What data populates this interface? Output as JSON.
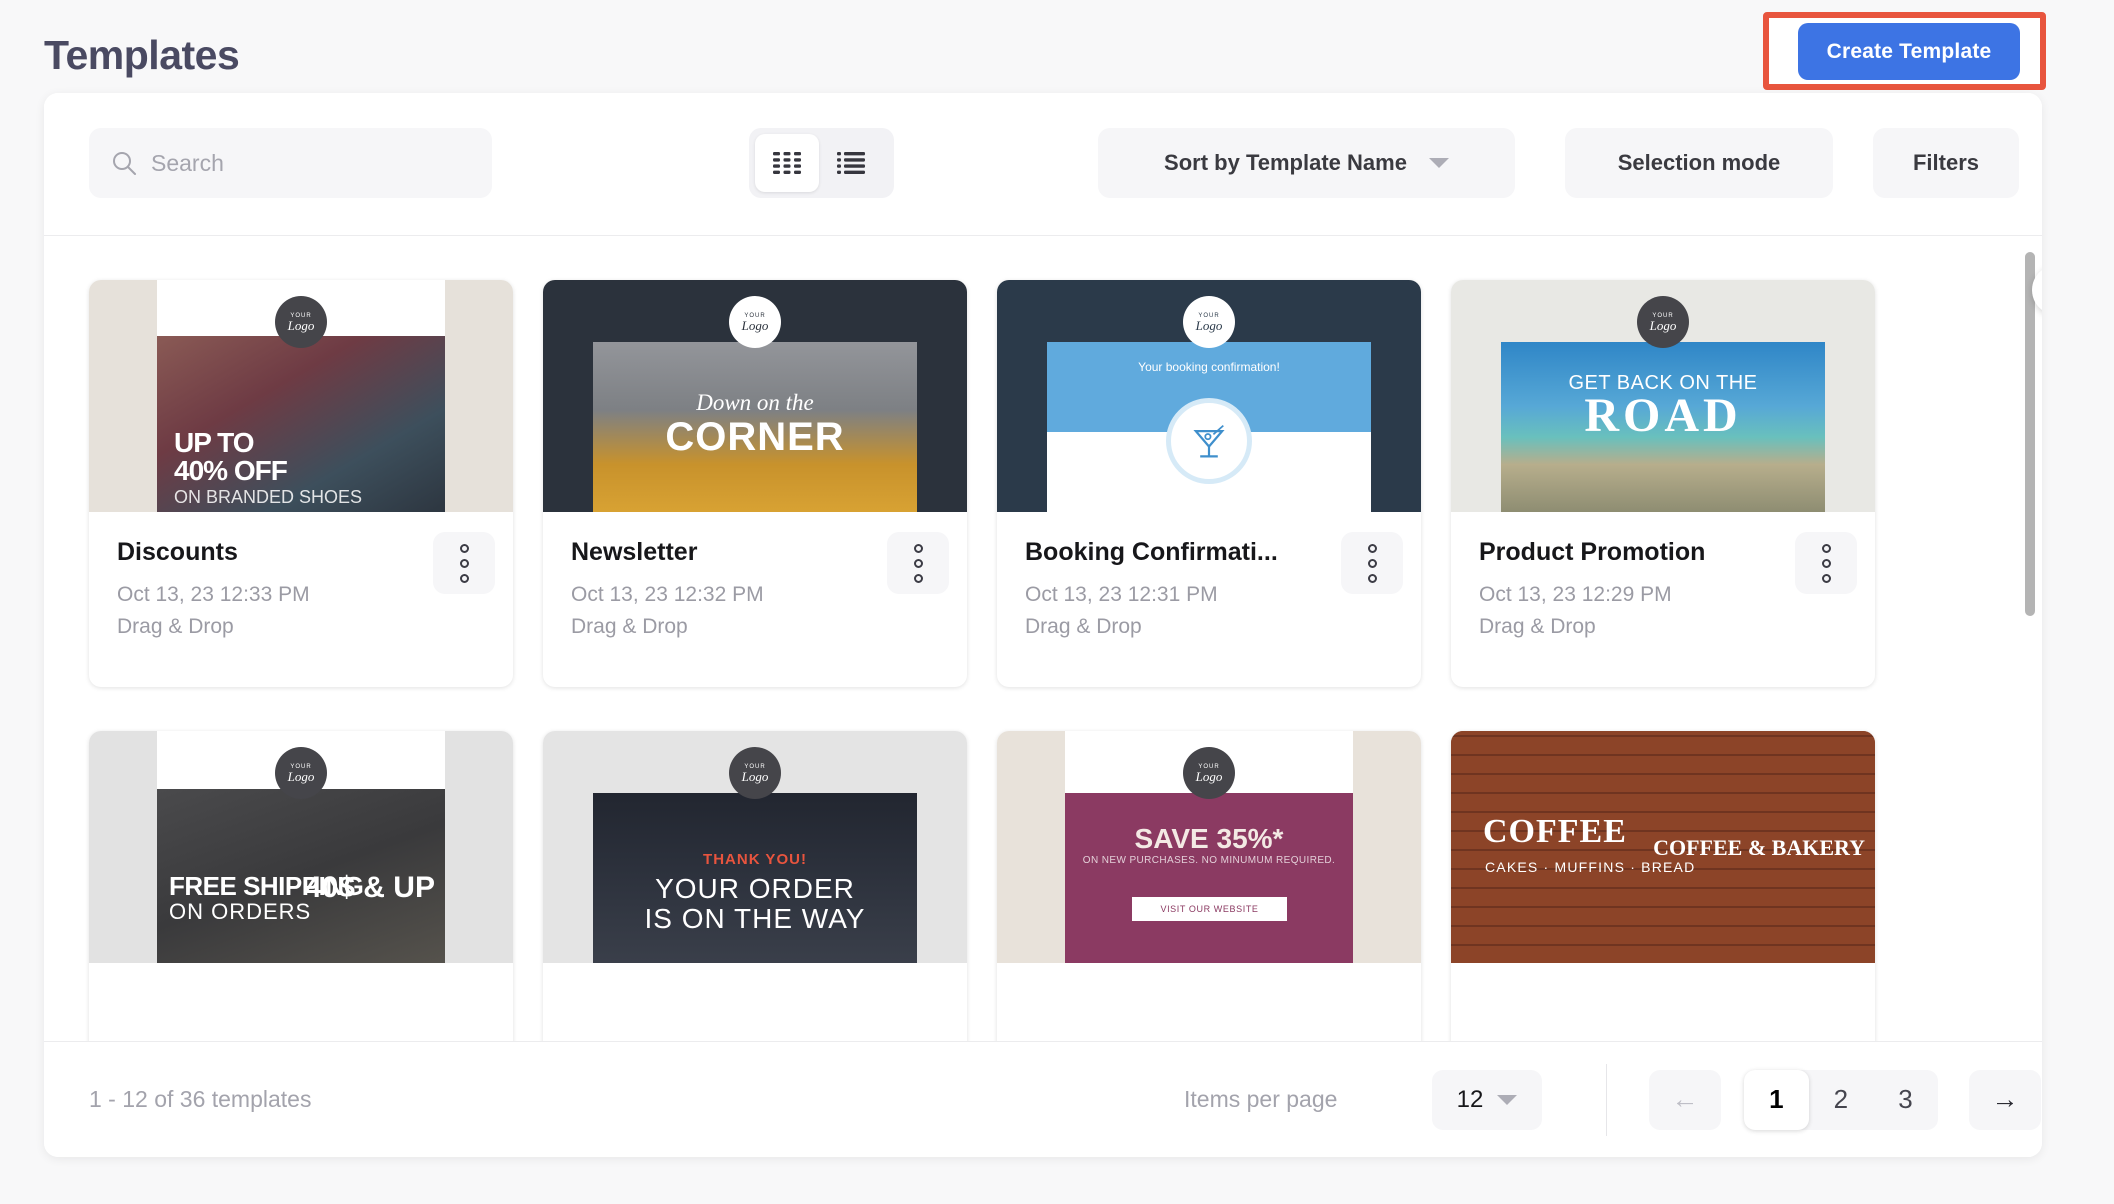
{
  "header": {
    "title": "Templates",
    "create_button_label": "Create Template",
    "highlight_color": "#e8553e",
    "accent_color": "#3d74e4"
  },
  "toolbar": {
    "search_placeholder": "Search",
    "search_value": "",
    "search_icon": "search-icon",
    "grid_view_icon": "grid-view-icon",
    "list_view_icon": "list-view-icon",
    "active_view": "grid",
    "sort_label": "Sort by Template Name",
    "selection_mode_label": "Selection mode",
    "filters_label": "Filters",
    "collapse_icon": "chevron-left-icon"
  },
  "cards": [
    {
      "title": "Discounts",
      "date": "Oct 13, 23 12:33 PM",
      "type": "Drag & Drop",
      "logo_small": "YOUR",
      "logo_main": "Logo",
      "thumb_bg": "#e6e1da",
      "thumb_style": "discounts",
      "overlay_line1": "UP TO",
      "overlay_line2": "40% OFF",
      "overlay_line3": "ON BRANDED SHOES"
    },
    {
      "title": "Newsletter",
      "date": "Oct 13, 23 12:32 PM",
      "type": "Drag & Drop",
      "logo_small": "YOUR",
      "logo_main": "Logo",
      "thumb_bg": "#2b323c",
      "thumb_style": "newsletter",
      "overlay_line1": "Down on the",
      "overlay_line2": "CORNER",
      "overlay_line3": ""
    },
    {
      "title": "Booking Confirmati...",
      "date": "Oct 13, 23 12:31 PM",
      "type": "Drag & Drop",
      "logo_small": "YOUR",
      "logo_main": "Logo",
      "thumb_bg": "#2b3a4a",
      "thumb_style": "booking",
      "overlay_line1": "Your booking confirmation!",
      "overlay_line2": "",
      "overlay_line3": ""
    },
    {
      "title": "Product Promotion",
      "date": "Oct 13, 23 12:29 PM",
      "type": "Drag & Drop",
      "logo_small": "YOUR",
      "logo_main": "Logo",
      "thumb_bg": "#e8e8e4",
      "thumb_style": "promotion",
      "overlay_line1": "GET BACK ON THE",
      "overlay_line2": "ROAD",
      "overlay_line3": ""
    },
    {
      "title": "",
      "date": "",
      "type": "",
      "logo_small": "YOUR",
      "logo_main": "Logo",
      "thumb_bg": "#e2e2e2",
      "thumb_style": "shipping",
      "overlay_line1": "FREE SHIPPING",
      "overlay_line2": "ON ORDERS",
      "overlay_line3": "40$ & UP"
    },
    {
      "title": "",
      "date": "",
      "type": "",
      "logo_small": "YOUR",
      "logo_main": "Logo",
      "thumb_bg": "#e4e4e4",
      "thumb_style": "thankyou",
      "overlay_line1": "THANK YOU!",
      "overlay_line2": "YOUR ORDER",
      "overlay_line3": "IS ON THE WAY"
    },
    {
      "title": "",
      "date": "",
      "type": "",
      "logo_small": "YOUR",
      "logo_main": "Logo",
      "thumb_bg": "#e8e2da",
      "thumb_style": "coupon",
      "overlay_line1": "SAVE 35%*",
      "overlay_line2": "ON NEW PURCHASES. NO MINUMUM REQUIRED.",
      "overlay_line3": "VISIT OUR WEBSITE"
    },
    {
      "title": "",
      "date": "",
      "type": "",
      "logo_small": "",
      "logo_main": "",
      "thumb_bg": "#7a3a22",
      "thumb_style": "coffee",
      "overlay_line1": "COFFEE",
      "overlay_line2": "CAKES · MUFFINS · BREAD",
      "overlay_line3": "COFFEE & BAKERY"
    }
  ],
  "footer": {
    "count_text": "1 - 12 of 36 templates",
    "items_per_page_label": "Items per page",
    "items_per_page_value": "12",
    "prev_label": "←",
    "next_label": "→",
    "pages": [
      "1",
      "2",
      "3"
    ],
    "active_page": "1"
  }
}
